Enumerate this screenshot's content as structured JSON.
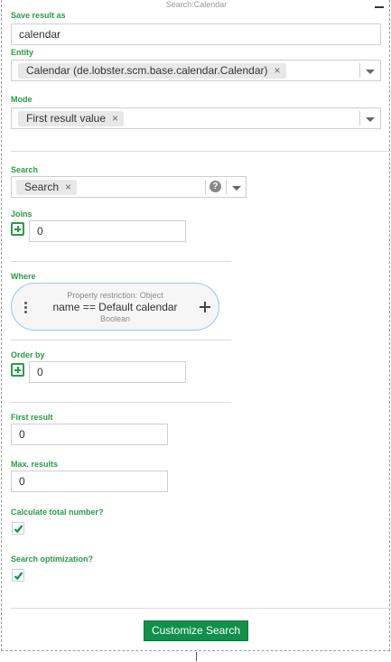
{
  "panel": {
    "title": "Search:Calendar"
  },
  "save_result": {
    "label": "Save result as",
    "value": "calendar"
  },
  "entity": {
    "label": "Entity",
    "chip": "Calendar (de.lobster.scm.base.calendar.Calendar)",
    "remove": "×"
  },
  "mode": {
    "label": "Mode",
    "chip": "First result value",
    "remove": "×"
  },
  "search": {
    "label": "Search",
    "chip": "Search",
    "remove": "×",
    "help": "?"
  },
  "joins": {
    "label": "Joins",
    "value": "0"
  },
  "where": {
    "label": "Where",
    "restriction_type": "Property restriction: Object",
    "expression": "name == Default calendar",
    "value_type": "Boolean"
  },
  "order_by": {
    "label": "Order by",
    "value": "0"
  },
  "first_result": {
    "label": "First result",
    "value": "0"
  },
  "max_results": {
    "label": "Max. results",
    "value": "0"
  },
  "calculate_total": {
    "label": "Calculate total number?",
    "checked": true
  },
  "search_optimization": {
    "label": "Search optimization?",
    "checked": true
  },
  "actions": {
    "customize_label": "Customize Search"
  },
  "colors": {
    "accent": "#2b9a4a",
    "button": "#11904a",
    "pill_border": "#9fc5e6"
  }
}
